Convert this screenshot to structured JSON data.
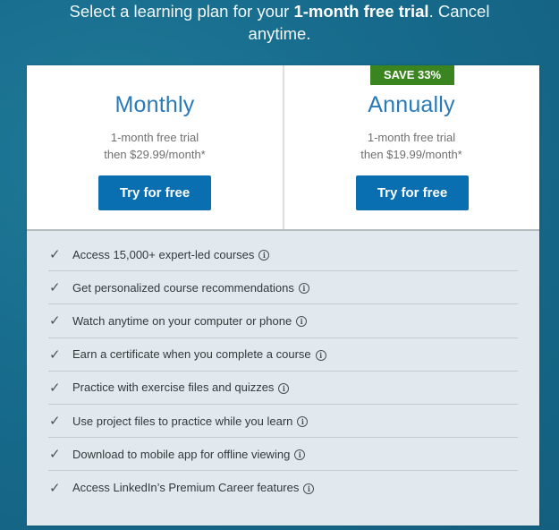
{
  "headline": {
    "prefix": "Select a learning plan for your ",
    "bold": "1-month free trial",
    "suffix": ". Cancel",
    "line2": "anytime."
  },
  "plans": [
    {
      "title": "Monthly",
      "trial": "1-month free trial",
      "price": "then $29.99/month*",
      "button": "Try for free",
      "badge": null
    },
    {
      "title": "Annually",
      "trial": "1-month free trial",
      "price": "then $19.99/month*",
      "button": "Try for free",
      "badge": "SAVE 33%"
    }
  ],
  "features": [
    {
      "text": "Access 15,000+ expert-led courses",
      "icon": "info-icon"
    },
    {
      "text": "Get personalized course recommendations",
      "icon": "info-icon"
    },
    {
      "text": "Watch anytime on your computer or phone",
      "icon": "info-icon"
    },
    {
      "text": "Earn a certificate when you complete a course",
      "icon": "info-icon"
    },
    {
      "text": "Practice with exercise files and quizzes",
      "icon": "info-icon"
    },
    {
      "text": "Use project files to practice while you learn",
      "icon": "info-icon"
    },
    {
      "text": "Download to mobile app for offline viewing",
      "icon": "info-icon"
    },
    {
      "text": "Access LinkedIn’s Premium Career features",
      "icon": "info-icon"
    }
  ],
  "glyphs": {
    "check": "✓",
    "info": "i"
  },
  "colors": {
    "accent": "#0a6fb1",
    "badge": "#3b8521",
    "title": "#2a7ab8",
    "background": "#176b8c"
  }
}
